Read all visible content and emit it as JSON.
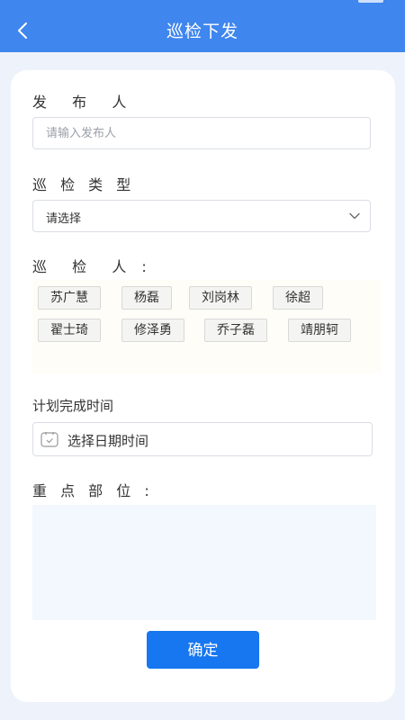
{
  "header": {
    "title": "巡检下发",
    "back_icon": "chevron-left-icon"
  },
  "form": {
    "publisher_label": "发  布  人",
    "publisher_placeholder": "请输入发布人",
    "type_label": "巡 检 类 型",
    "type_value": "请选择",
    "inspectors_label": "巡  检  人 :",
    "inspectors": [
      "苏广慧",
      "杨磊",
      "刘岗林",
      "徐超",
      "翟士琦",
      "修泽勇",
      "乔子磊",
      "靖朋轲"
    ],
    "deadline_label": "计划完成时间",
    "deadline_value": "选择日期时间",
    "key_area_label": "重 点 部 位 :",
    "key_area_value": "",
    "confirm_label": "确定"
  },
  "colors": {
    "header_bg": "#3f86ee",
    "confirm_bg": "#1677f0",
    "key_area_bg": "#f2f8fe"
  }
}
